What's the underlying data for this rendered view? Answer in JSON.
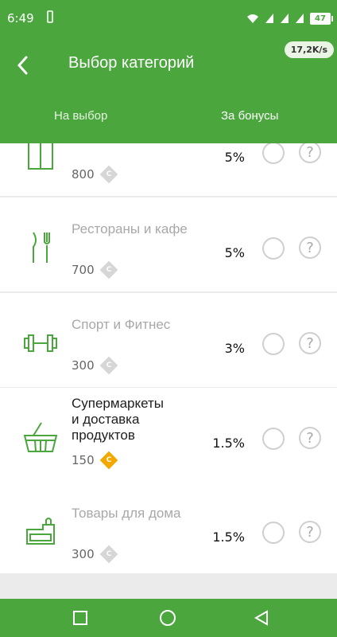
{
  "status_bar": {
    "time": "6:49",
    "network_speed": "17,2K/s",
    "battery": "47"
  },
  "app_bar": {
    "title": "Выбор категорий",
    "tabs": [
      {
        "label": "На выбор",
        "selected": false
      },
      {
        "label": "За бонусы",
        "selected": true
      }
    ]
  },
  "categories": [
    {
      "name": "",
      "cost": "800",
      "percent": "5%",
      "icon": "shirt-icon",
      "selected": false,
      "affordable": false
    },
    {
      "name": "Рестораны и кафе",
      "cost": "700",
      "percent": "5%",
      "icon": "fork-knife-icon",
      "selected": false,
      "affordable": false
    },
    {
      "name": "Спорт и Фитнес",
      "cost": "300",
      "percent": "3%",
      "icon": "dumbbell-icon",
      "selected": false,
      "affordable": false
    },
    {
      "name": "Супермаркеты\nи доставка\nпродуктов",
      "cost": "150",
      "percent": "1.5%",
      "icon": "basket-icon",
      "selected": false,
      "affordable": true
    },
    {
      "name": "Товары для дома",
      "cost": "300",
      "percent": "1.5%",
      "icon": "sofa-icon",
      "selected": false,
      "affordable": false
    }
  ],
  "coin_symbol": "С",
  "help_symbol": "?",
  "colors": {
    "brand_green": "#4aa63d",
    "coin_gold": "#f3a800",
    "coin_gray": "#d6d6d6"
  }
}
